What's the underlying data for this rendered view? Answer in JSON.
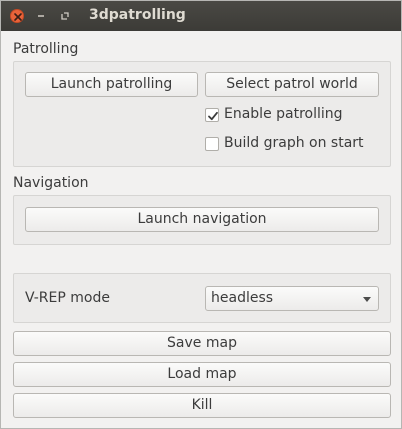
{
  "window": {
    "title": "3dpatrolling"
  },
  "icons": {
    "close": "close-icon",
    "minimize": "minimize-icon",
    "maximize": "maximize-icon",
    "checkmark": "checkmark-icon",
    "dropdown": "chevron-down-icon"
  },
  "patrolling": {
    "section_label": "Patrolling",
    "launch_label": "Launch patrolling",
    "select_world_label": "Select patrol world",
    "enable_label": "Enable patrolling",
    "enable_checked": true,
    "build_graph_label": "Build graph on start",
    "build_graph_checked": false
  },
  "navigation": {
    "section_label": "Navigation",
    "launch_label": "Launch navigation"
  },
  "vrep": {
    "mode_label": "V-REP mode",
    "mode_value": "headless"
  },
  "actions": {
    "save_map_label": "Save map",
    "load_map_label": "Load map",
    "kill_label": "Kill"
  },
  "colors": {
    "titlebar": "#3c3b37",
    "close_button": "#e9633a",
    "background": "#f2f1f0"
  }
}
